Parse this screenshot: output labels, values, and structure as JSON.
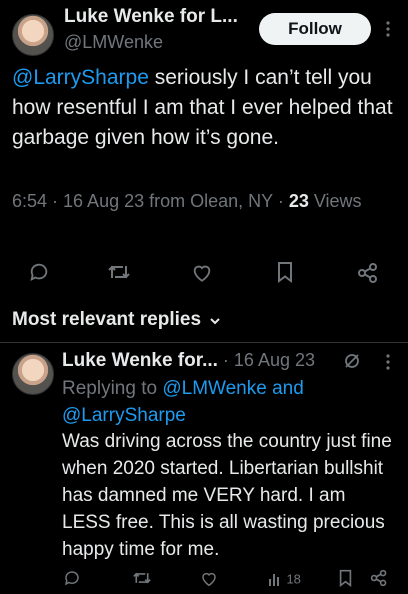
{
  "main_tweet": {
    "author_name": "Luke Wenke for L...",
    "handle": "@LMWenke",
    "follow_label": "Follow",
    "text_mention": "@LarrySharpe",
    "text_rest": " seriously I can’t tell you how resentful I am that I ever helped that garbage given how it’s gone.",
    "meta_time": "6:54 · 16 Aug 23 from Olean, NY · ",
    "views_count": "23",
    "views_label": " Views"
  },
  "sort": {
    "label": "Most relevant replies"
  },
  "reply": {
    "author_name": "Luke Wenke for...",
    "date": " · 16 Aug 23",
    "replying_prefix": "Replying to ",
    "replying_to_1": "@LMWenke",
    "replying_and": " and",
    "replying_to_2": "@LarrySharpe",
    "text": "Was driving across the country just fine when 2020 started.  Libertarian bullshit has damned me VERY hard. I am LESS free.  This is all wasting precious happy time for me.",
    "views_count": "18"
  },
  "colors": {
    "accent": "#1d9bf0",
    "text": "#e7e9ea",
    "muted": "#71767b",
    "divider": "#2f3336"
  },
  "icons": [
    "reply-icon",
    "retweet-icon",
    "like-icon",
    "bookmark-icon",
    "share-icon",
    "more-icon",
    "chevron-down-icon",
    "grok-icon",
    "views-icon"
  ]
}
